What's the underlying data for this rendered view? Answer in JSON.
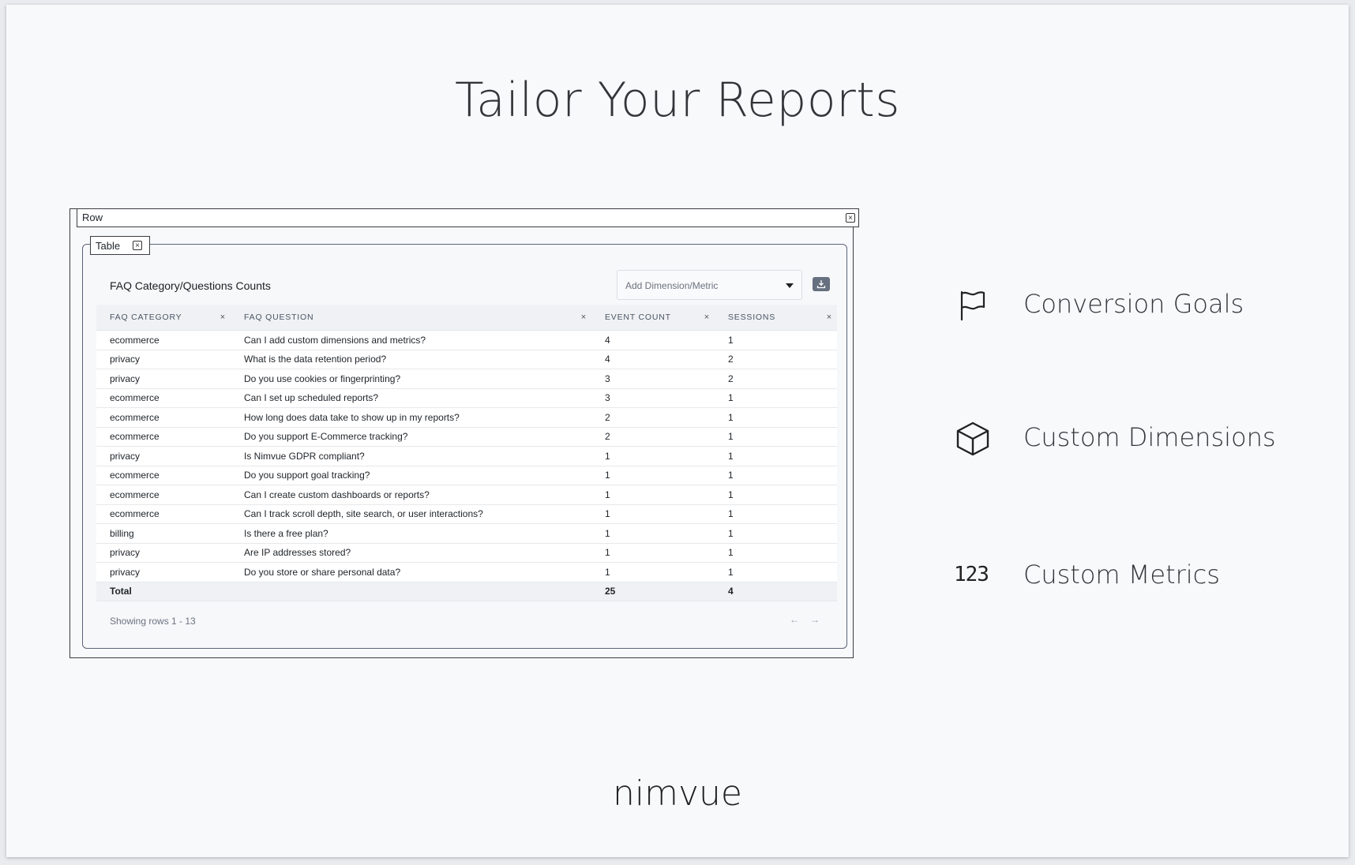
{
  "title": "Tailor Your Reports",
  "brand": "nimvue",
  "row_label": "Row",
  "table_label": "Table",
  "card_title": "FAQ Category/Questions Counts",
  "dropdown_placeholder": "Add Dimension/Metric",
  "columns": [
    "FAQ CATEGORY",
    "FAQ QUESTION",
    "EVENT COUNT",
    "SESSIONS"
  ],
  "rows": [
    [
      "ecommerce",
      "Can I add custom dimensions and metrics?",
      "4",
      "1"
    ],
    [
      "privacy",
      "What is the data retention period?",
      "4",
      "2"
    ],
    [
      "privacy",
      "Do you use cookies or fingerprinting?",
      "3",
      "2"
    ],
    [
      "ecommerce",
      "Can I set up scheduled reports?",
      "3",
      "1"
    ],
    [
      "ecommerce",
      "How long does data take to show up in my reports?",
      "2",
      "1"
    ],
    [
      "ecommerce",
      "Do you support E-Commerce tracking?",
      "2",
      "1"
    ],
    [
      "privacy",
      "Is Nimvue GDPR compliant?",
      "1",
      "1"
    ],
    [
      "ecommerce",
      "Do you support goal tracking?",
      "1",
      "1"
    ],
    [
      "ecommerce",
      "Can I create custom dashboards or reports?",
      "1",
      "1"
    ],
    [
      "ecommerce",
      "Can I track scroll depth, site search, or user interactions?",
      "1",
      "1"
    ],
    [
      "billing",
      "Is there a free plan?",
      "1",
      "1"
    ],
    [
      "privacy",
      "Are IP addresses stored?",
      "1",
      "1"
    ],
    [
      "privacy",
      "Do you store or share personal data?",
      "1",
      "1"
    ]
  ],
  "total": {
    "label": "Total",
    "event_count": "25",
    "sessions": "4"
  },
  "footer": "Showing rows 1 - 13",
  "pager": {
    "prev": "←",
    "next": "→"
  },
  "features": [
    {
      "label": "Conversion Goals",
      "icon": "flag-icon"
    },
    {
      "label": "Custom Dimensions",
      "icon": "cube-icon"
    },
    {
      "label": "Custom Metrics",
      "icon": "numbers-icon",
      "icon_text": "123"
    }
  ]
}
